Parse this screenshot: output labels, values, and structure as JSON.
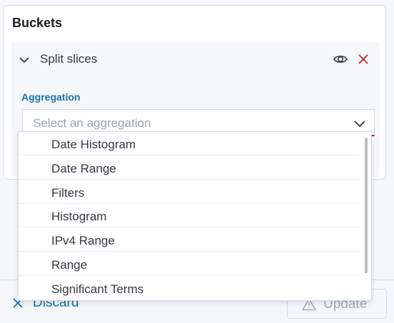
{
  "panel": {
    "title": "Buckets",
    "bucket": {
      "label": "Split slices",
      "toggle_icon": "chevron-down-icon",
      "visibility_icon": "eye-icon",
      "remove_icon": "close-icon"
    },
    "aggregation": {
      "label": "Aggregation",
      "placeholder": "Select an aggregation",
      "chevron_icon": "chevron-down-icon",
      "options": [
        "Date Histogram",
        "Date Range",
        "Filters",
        "Histogram",
        "IPv4 Range",
        "Range",
        "Significant Terms"
      ]
    }
  },
  "footer": {
    "discard_label": "Discard",
    "discard_icon": "close-icon",
    "update_label": "Update",
    "update_icon": "warning-icon"
  },
  "colors": {
    "accent": "#1a6fae",
    "danger": "#bd271e",
    "text": "#343741",
    "placeholder": "#98a2b3",
    "disabled": "#a2abba"
  }
}
